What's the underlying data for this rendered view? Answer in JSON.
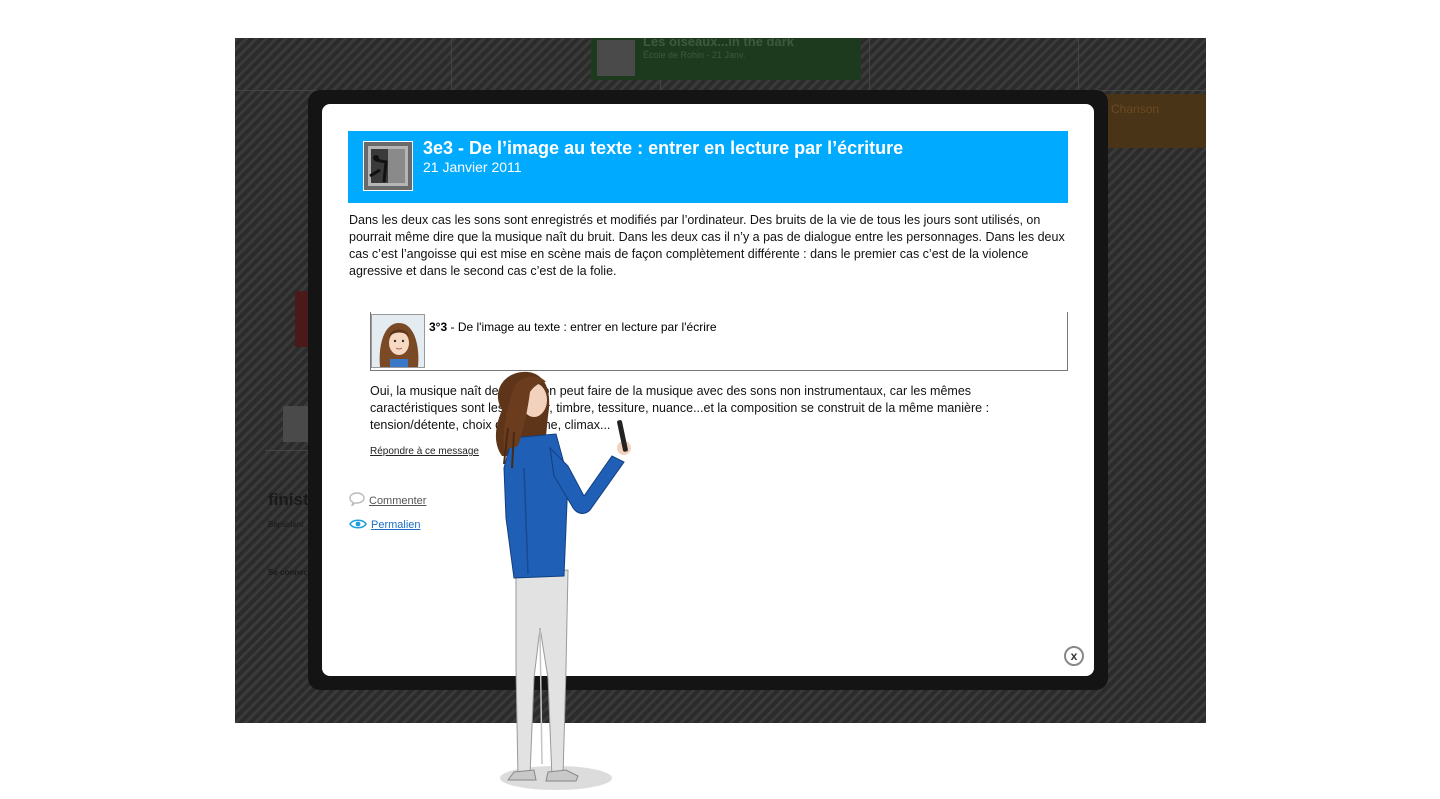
{
  "background": {
    "featured_title": "Les oiseaux...in the dark",
    "featured_subtitle": "École de Rohin - 21 Janv.",
    "orange_label": "Chanson",
    "section_title": "finiste",
    "small_text_1": "Bapsidant",
    "small_text_2": "Se connecter"
  },
  "post": {
    "title": "3e3 - De l’image au texte : entrer en lecture par l’écriture",
    "date": "21 Janvier 2011",
    "body": "Dans les deux cas les sons sont enregistrés et modifiés par l’ordinateur. Des bruits de la vie de tous les jours sont utilisés, on pourrait même dire que la musique naît du bruit. Dans les deux cas il n’y a pas de dialogue entre les personnages. Dans les deux cas c’est l’angoisse qui est mise en scène mais de façon complètement différente : dans le premier cas c’est de la violence agressive et dans le second cas c’est de la folie."
  },
  "comment": {
    "ref_number": "3°3",
    "ref_text": " - De l'image au texte : entrer en lecture par l'écrire",
    "text": "Oui, la musique naît de bruit. L’on peut faire de la musique avec des sons non instrumentaux, car les mêmes caractéristiques sont les hauteur, timbre, tessiture, nuance...et la composition se construit de la même manière : tension/détente, choix de la forme, climax...",
    "reply_label": "Répondre à ce message"
  },
  "actions": {
    "comment_label": "Commenter",
    "permalink_label": "Permalien"
  },
  "close_label": "x",
  "colors": {
    "header_bg": "#00aaff",
    "permalink": "#1a6fc4",
    "mascot_shirt": "#1f5fb5"
  },
  "icons": [
    "speech-bubble-icon",
    "eye-icon",
    "close-icon"
  ]
}
